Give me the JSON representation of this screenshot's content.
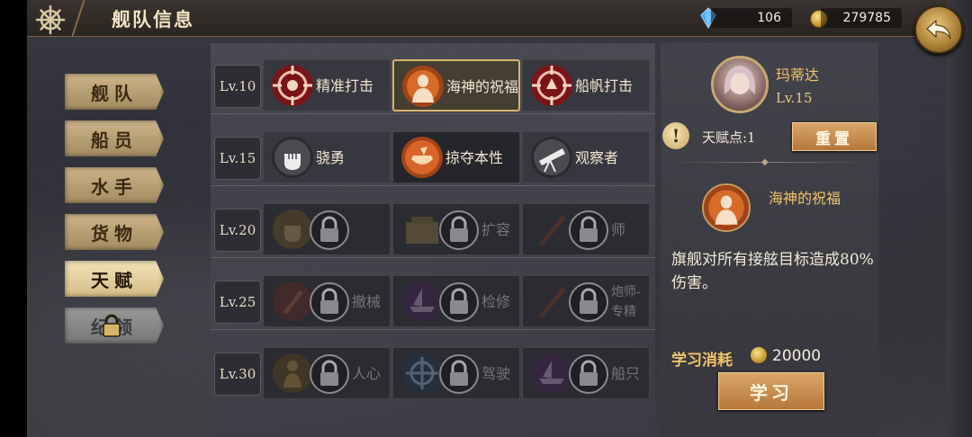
{
  "header": {
    "title": "舰队信息",
    "gems": "106",
    "gold": "279785"
  },
  "colors": {
    "accent": "#f0c468",
    "button": "#c88a4c",
    "selected_border": "#d6b46a"
  },
  "tabs": [
    {
      "label": "舰队",
      "state": "normal"
    },
    {
      "label": "船员",
      "state": "normal"
    },
    {
      "label": "水手",
      "state": "normal"
    },
    {
      "label": "货物",
      "state": "normal"
    },
    {
      "label": "天赋",
      "state": "active"
    },
    {
      "label": "纪领",
      "state": "locked"
    }
  ],
  "talent_rows": [
    {
      "level": "Lv.10",
      "nodes": [
        {
          "name": "精准打击",
          "icon": "target-icon",
          "state": "unlocked"
        },
        {
          "name": "海神的祝福",
          "icon": "sea-god-icon",
          "state": "selected"
        },
        {
          "name": "船帆打击",
          "icon": "target-icon",
          "state": "unlocked"
        }
      ]
    },
    {
      "level": "Lv.15",
      "nodes": [
        {
          "name": "骁勇",
          "icon": "fist-icon",
          "state": "unlocked"
        },
        {
          "name": "掠夺本性",
          "icon": "treasure-icon",
          "state": "unlocked"
        },
        {
          "name": "观察者",
          "icon": "telescope-icon",
          "state": "unlocked"
        }
      ]
    },
    {
      "level": "Lv.20",
      "nodes": [
        {
          "name": "",
          "icon": "fist-icon",
          "state": "locked"
        },
        {
          "name": "扩容",
          "icon": "cargo-icon",
          "state": "locked"
        },
        {
          "name": "师",
          "icon": "sword-icon",
          "state": "locked"
        }
      ]
    },
    {
      "level": "Lv.25",
      "nodes": [
        {
          "name": "撤械",
          "icon": "knife-icon",
          "state": "locked"
        },
        {
          "name": "检修",
          "icon": "ship-icon",
          "state": "locked"
        },
        {
          "name": "炮师-专精",
          "icon": "sword-icon",
          "state": "locked"
        }
      ]
    },
    {
      "level": "Lv.30",
      "nodes": [
        {
          "name": "人心",
          "icon": "person-icon",
          "state": "locked"
        },
        {
          "name": "驾驶",
          "icon": "helm-icon",
          "state": "locked"
        },
        {
          "name": "船只",
          "icon": "ship-icon",
          "state": "locked"
        }
      ]
    }
  ],
  "detail": {
    "captain_name": "玛蒂达",
    "captain_level": "Lv.15",
    "points_label": "天赋点:1",
    "reset_label": "重置",
    "selected_name": "海神的祝福",
    "description": "旗舰对所有接舷目标造成80%伤害。",
    "cost_label": "学习消耗",
    "cost_value": "20000",
    "learn_label": "学习"
  }
}
